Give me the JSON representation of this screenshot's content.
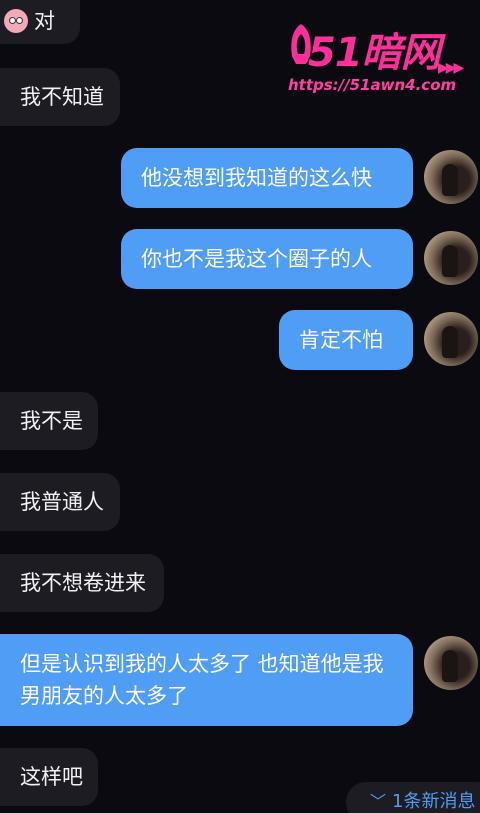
{
  "messages": [
    {
      "dir": "in",
      "text": "对",
      "emoji": true
    },
    {
      "dir": "in",
      "text": "我不知道"
    },
    {
      "dir": "out",
      "text": "他没想到我知道的这么快"
    },
    {
      "dir": "out",
      "text": "你也不是我这个圈子的人"
    },
    {
      "dir": "out",
      "text": "肯定不怕"
    },
    {
      "dir": "in",
      "text": "我不是"
    },
    {
      "dir": "in",
      "text": "我普通人"
    },
    {
      "dir": "in",
      "text": "我不想卷进来"
    },
    {
      "dir": "out",
      "text": "但是认识到我的人太多了 也知道他是我男朋友的人太多了"
    },
    {
      "dir": "in",
      "text": "这样吧"
    }
  ],
  "watermark": {
    "title": "51暗网",
    "url": "https://51awn4.com",
    "arrows": "▶▶▶"
  },
  "new_messages": {
    "icon": "chevron-down-icon",
    "label": "1条新消息"
  },
  "colors": {
    "background": "#0b0a10",
    "incoming_bubble": "#1d1c22",
    "outgoing_bubble": "#4f9df5",
    "watermark": "#ff2f9a"
  }
}
